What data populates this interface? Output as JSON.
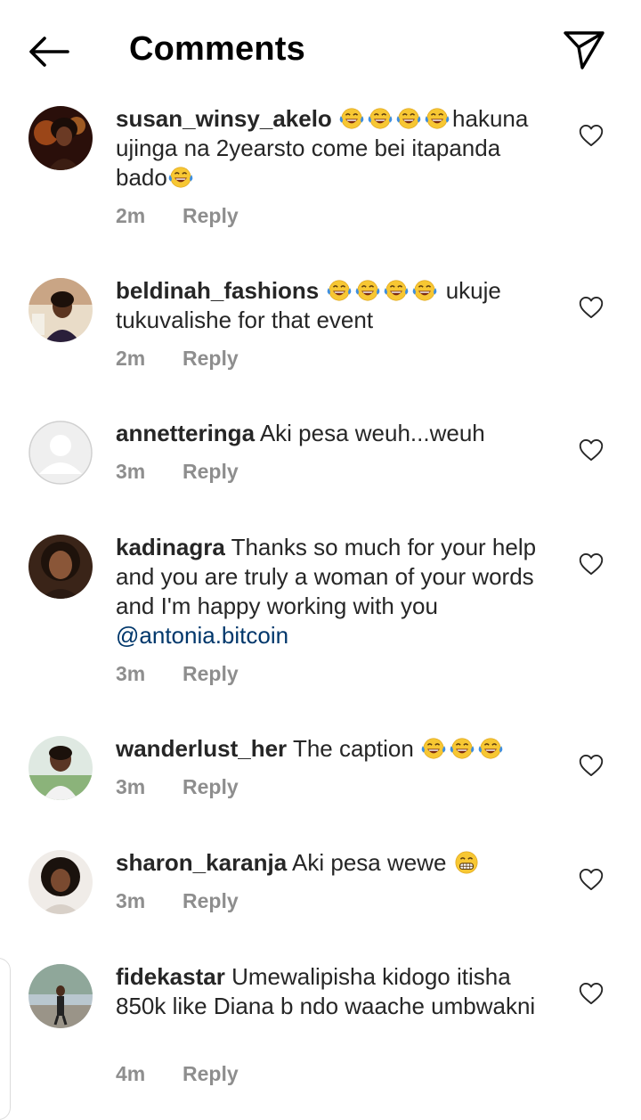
{
  "header": {
    "title": "Comments",
    "back_icon": "arrow-left-icon",
    "send_icon": "paper-plane-icon"
  },
  "comments": [
    {
      "username": "susan_winsy_akelo",
      "text_before": "",
      "text_after": "hakuna ujinga na 2yearsto come bei itapanda bado",
      "time": "2m",
      "reply": "Reply"
    },
    {
      "username": "beldinah_fashions",
      "text_after": " ukuje tukuvalishe for that event",
      "time": "2m",
      "reply": "Reply"
    },
    {
      "username": "annetteringa",
      "text": "Aki pesa weuh...weuh",
      "time": "3m",
      "reply": "Reply"
    },
    {
      "username": "kadinagra",
      "text": "Thanks so much for your help and you are truly a woman of your words and I'm happy working with you",
      "mention": "@antonia.bitcoin",
      "time": "3m",
      "reply": "Reply"
    },
    {
      "username": "wanderlust_her",
      "text": "The caption",
      "time": "3m",
      "reply": "Reply"
    },
    {
      "username": "sharon_karanja",
      "text": "Aki pesa wewe",
      "time": "3m",
      "reply": "Reply"
    },
    {
      "username": "fidekastar",
      "text": "Umewalipisha kidogo itisha 850k like Diana b ndo waache umbwakni",
      "time": "4m",
      "reply": "Reply"
    }
  ],
  "colors": {
    "text": "#262626",
    "muted": "#8e8e8e",
    "mention": "#00376b",
    "emoji_face": "#f7c733",
    "emoji_tears": "#3f8fe0"
  }
}
